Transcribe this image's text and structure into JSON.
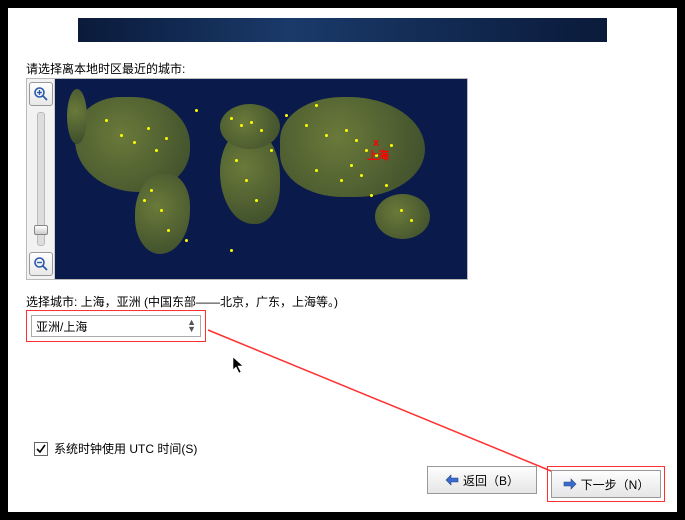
{
  "instruction": "请选择离本地时区最近的城市:",
  "marker": {
    "label": "上海",
    "symbol": "x"
  },
  "city_desc_prefix": "选择城市: ",
  "city_desc_value": "上海，亚洲 (中国东部——北京，广东，上海等。)",
  "combo": {
    "value": "亚洲/上海"
  },
  "utc_checkbox": {
    "label": "系统时钟使用 UTC 时间(S)",
    "checked": true
  },
  "buttons": {
    "back": "返回（B）",
    "next": "下一步（N）"
  },
  "colors": {
    "accent_red": "#ff3030"
  }
}
